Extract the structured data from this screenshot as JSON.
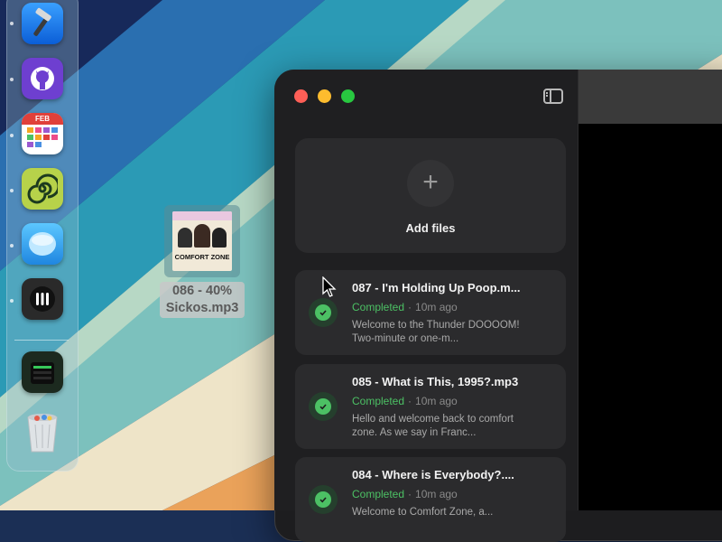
{
  "colors": {
    "accent_green": "#4cc064",
    "window_bg": "#1d1d1f",
    "card_bg": "#2b2b2d",
    "traffic_red": "#fe5f57",
    "traffic_yellow": "#febc2e",
    "traffic_green": "#28c840"
  },
  "dock": {
    "apps": [
      {
        "name": "xcode",
        "icon": "hammer-icon"
      },
      {
        "name": "github-desktop",
        "icon": "github-octocat-icon"
      },
      {
        "name": "fantastical",
        "icon": "calendar-icon",
        "badge_text": "FEB"
      },
      {
        "name": "spiral-app",
        "icon": "spiral-icon"
      },
      {
        "name": "bubble-app",
        "icon": "bubble-icon"
      },
      {
        "name": "audio-app",
        "icon": "bars-icon"
      },
      {
        "name": "server-app",
        "icon": "server-icon"
      },
      {
        "name": "trash",
        "icon": "trash-icon"
      }
    ]
  },
  "desktop_file": {
    "label_line1": "086 - 40%",
    "label_line2": "Sickos.mp3",
    "artwork_text": "COMFORT ZONE"
  },
  "window": {
    "add_files_label": "Add files",
    "add_icon": "plus-icon",
    "items": [
      {
        "title": "087 - I'm Holding Up Poop.m...",
        "status": "Completed",
        "separator": "·",
        "time": "10m ago",
        "description": "Welcome to the Thunder DOOOOM! Two-minute or one-m..."
      },
      {
        "title": "085 - What is This, 1995?.mp3",
        "status": "Completed",
        "separator": "·",
        "time": "10m ago",
        "description": "Hello and welcome back to comfort zone. As we say in Franc..."
      },
      {
        "title": "084 - Where is Everybody?....",
        "status": "Completed",
        "separator": "·",
        "time": "10m ago",
        "description": "Welcome to Comfort Zone, a..."
      }
    ]
  }
}
